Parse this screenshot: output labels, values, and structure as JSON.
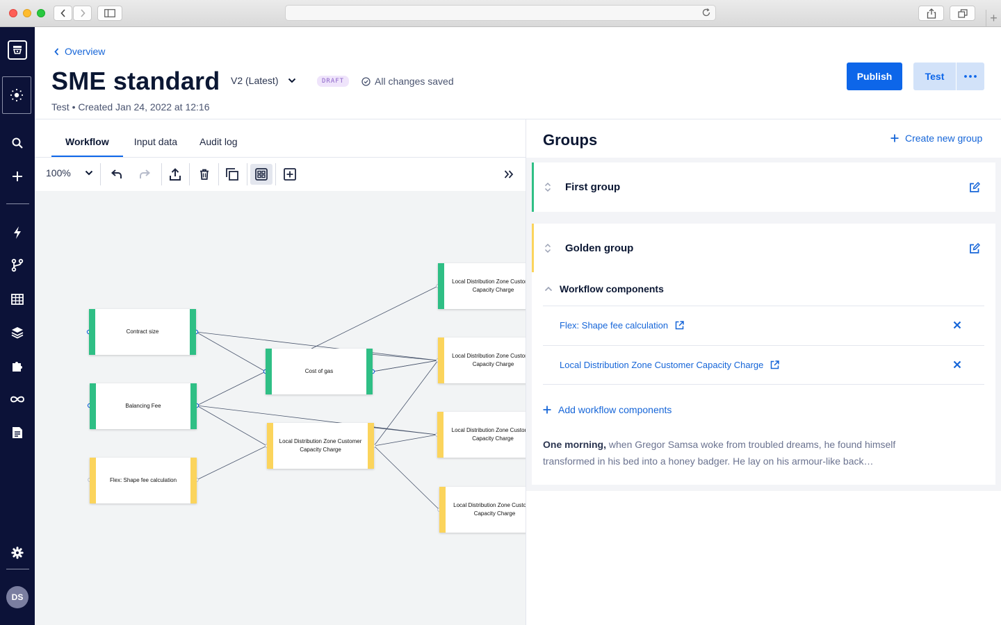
{
  "app": {
    "back_link": "Overview",
    "title": "SME standard",
    "version": "V2 (Latest)",
    "status_badge": "DRAFT",
    "save_status": "All changes saved",
    "meta": "Test • Created Jan 24, 2022 at 12:16",
    "publish_label": "Publish",
    "test_label": "Test",
    "avatar_initials": "DS"
  },
  "tabs": [
    {
      "label": "Workflow",
      "active": true
    },
    {
      "label": "Input data",
      "active": false
    },
    {
      "label": "Audit log",
      "active": false
    }
  ],
  "toolbar": {
    "zoom": "100%"
  },
  "canvas": {
    "nodes": [
      {
        "label": "Contract size",
        "color": "green"
      },
      {
        "label": "Balancing Fee",
        "color": "green"
      },
      {
        "label": "Flex: Shape fee calculation",
        "color": "yellow"
      },
      {
        "label": "Cost of gas",
        "color": "green"
      },
      {
        "label": "Local Distribution Zone Customer Capacity Charge",
        "color": "yellow"
      },
      {
        "label": "Local Distribution Zone Customer Capacity Charge",
        "color": "green"
      },
      {
        "label": "Local Distribution Zone Customer Capacity Charge",
        "color": "yellow"
      },
      {
        "label": "Local Distribution Zone Customer Capacity Charge",
        "color": "yellow"
      },
      {
        "label": "Local Distribution Zone Customer Capacity Charge",
        "color": "yellow"
      }
    ]
  },
  "groups_panel": {
    "title": "Groups",
    "create_label": "Create new group",
    "groups": [
      {
        "name": "First group",
        "color": "#2fbf85"
      },
      {
        "name": "Golden group",
        "color": "#fbd45c"
      }
    ],
    "workflow_components_label": "Workflow components",
    "components": [
      {
        "label": "Flex: Shape fee calculation"
      },
      {
        "label": "Local Distribution Zone Customer Capacity Charge"
      }
    ],
    "add_components_label": "Add workflow components",
    "description_lead": "One morning,",
    "description_rest": " when Gregor Samsa woke from troubled dreams, he found himself transformed in his bed into a honey badger. He lay on his armour-like back…"
  },
  "colors": {
    "accent": "#0d66e9",
    "rail": "#0c1238",
    "green": "#2fbf85",
    "yellow": "#fbd45c"
  }
}
